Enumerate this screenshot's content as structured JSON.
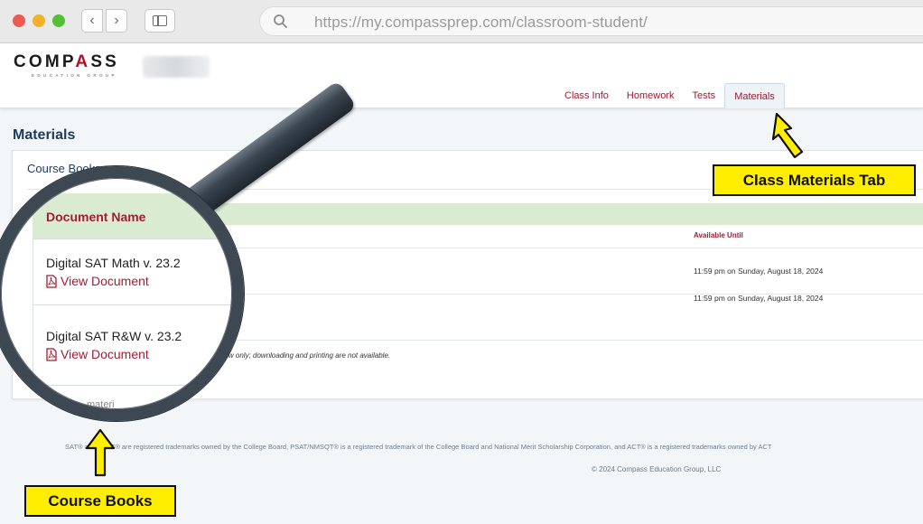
{
  "browser": {
    "url": "https://my.compassprep.com/classroom-student/",
    "back_icon": "‹",
    "forward_icon": "›"
  },
  "header": {
    "logo_prefix": "COMP",
    "logo_accent": "A",
    "logo_suffix": "SS",
    "logo_subtitle": "EDUCATION GROUP",
    "tabs": [
      {
        "label": "Class Info",
        "active": false
      },
      {
        "label": "Homework",
        "active": false
      },
      {
        "label": "Tests",
        "active": false
      },
      {
        "label": "Materials",
        "active": true
      }
    ]
  },
  "main": {
    "title": "Materials",
    "section_title": "Course Books",
    "columns": {
      "document_name": "Document Name",
      "available_until": "Available Until"
    },
    "rows": [
      {
        "name": "Digital SAT Math v. 23.2",
        "link": "View Document",
        "available_until": "11:59 pm on Sunday, August 18, 2024"
      },
      {
        "name": "Digital SAT R&W v. 23.2",
        "link": "View Document",
        "available_until": "11:59 pm on Sunday, August 18, 2024"
      }
    ],
    "notice": "window only; downloading and printing are not available.",
    "other_section_fragment": "materi"
  },
  "footer": {
    "trademark": "SAT® and PSAT® are registered trademarks owned by the College Board, PSAT/NMSQT® is a registered trademark of the College Board and National Merit Scholarship Corporation, and ACT® is a registered trademarks owned by ACT",
    "copyright": "© 2024 Compass Education Group, LLC"
  },
  "callouts": {
    "materials_tab": "Class Materials Tab",
    "course_books": "Course Books"
  },
  "colors": {
    "brand_red": "#a31c33",
    "navy": "#1b3b5a",
    "callout_yellow": "#ffee00"
  }
}
